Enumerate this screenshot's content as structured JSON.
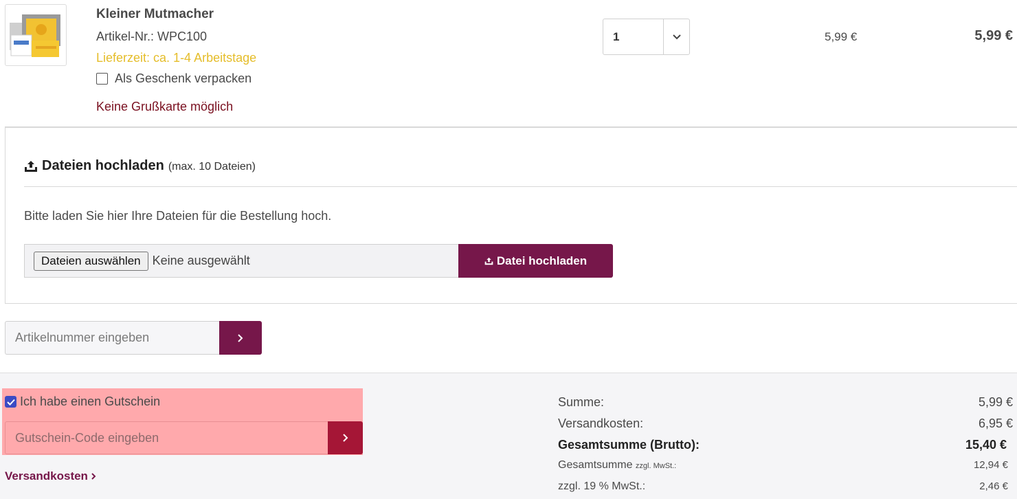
{
  "product": {
    "name": "Kleiner Mutmacher",
    "sku": "Artikel-Nr.: WPC100",
    "delivery": "Lieferzeit: ca. 1-4 Arbeitstage",
    "gift_label": "Als Geschenk verpacken",
    "gift_checked": false,
    "no_card": "Keine Grußkarte möglich",
    "quantity": "1",
    "unit_price": "5,99 €",
    "total_price": "5,99 €"
  },
  "upload": {
    "title": "Dateien hochladen",
    "subtitle": "(max. 10 Dateien)",
    "description": "Bitte laden Sie hier Ihre Dateien für die Bestellung hoch.",
    "choose_label": "Dateien auswählen",
    "none_selected": "Keine ausgewählt",
    "upload_button": "Datei hochladen"
  },
  "article": {
    "placeholder": "Artikelnummer eingeben"
  },
  "voucher": {
    "label": "Ich habe einen Gutschein",
    "checked": true,
    "placeholder": "Gutschein-Code eingeben"
  },
  "shipping_link": "Versandkosten",
  "summary": {
    "sum_label": "Summe:",
    "sum_value": "5,99 €",
    "shipping_label": "Versandkosten:",
    "shipping_value": "6,95 €",
    "gross_label": "Gesamtsumme (Brutto):",
    "gross_value": "15,40 €",
    "net_label": "Gesamtsumme",
    "net_small": "zzgl. MwSt.:",
    "net_value": "12,94 €",
    "vat_label": "zzgl. 19 % MwSt.:",
    "vat_value": "2,46 €"
  },
  "colors": {
    "brand": "#76174a",
    "delivery": "#e5bd2a",
    "highlight": "#ffa9ac",
    "voucher_button": "#a51636"
  }
}
